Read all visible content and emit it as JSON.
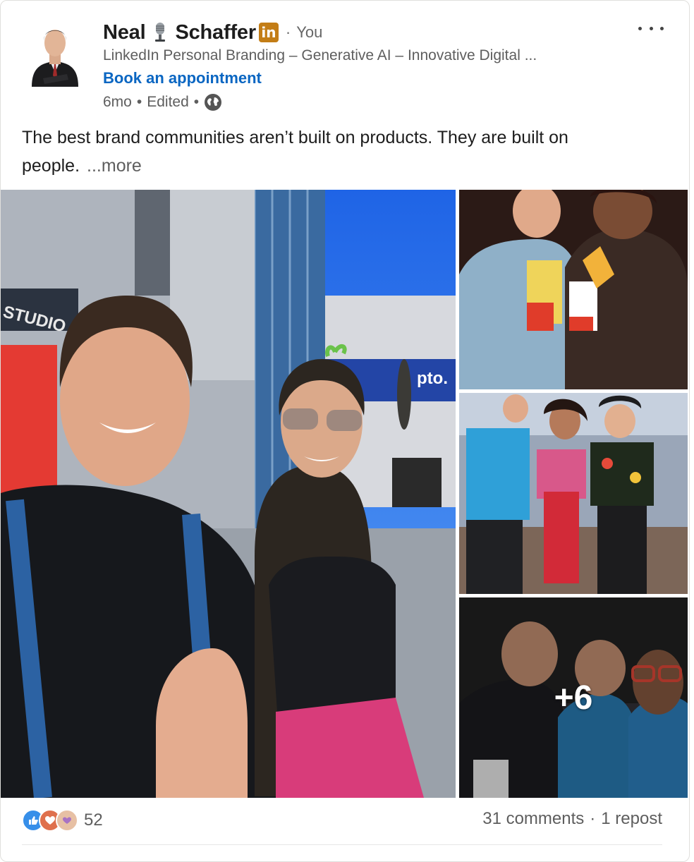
{
  "author": {
    "first_name": "Neal",
    "last_name": "Schaffer",
    "you_label": "You",
    "headline": "LinkedIn Personal Branding – Generative AI – Innovative Digital ...",
    "cta": "Book an appointment",
    "age": "6mo",
    "edited": "Edited"
  },
  "post": {
    "text": "The best brand communities aren’t built on products. They are built on people.",
    "more": "...more"
  },
  "gallery": {
    "more_count": "+6"
  },
  "social": {
    "reaction_count": "52",
    "comments": "31 comments",
    "reposts": "1 repost"
  },
  "colors": {
    "link": "#0a66c2",
    "linkedin_badge": "#c37d16",
    "like": "#378fe9",
    "love": "#df704d",
    "support": "#c37d16"
  },
  "icons": {
    "mic": "studio-microphone-icon",
    "globe": "globe-icon",
    "more": "ellipsis-icon"
  }
}
